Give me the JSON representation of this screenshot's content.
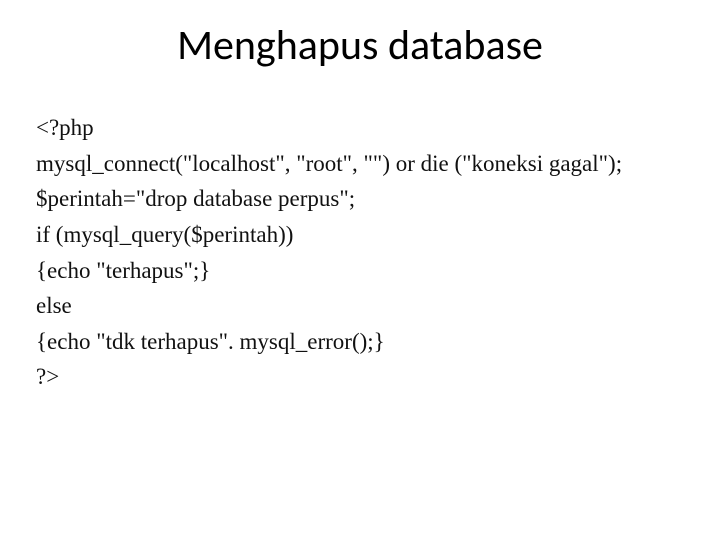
{
  "title": "Menghapus database",
  "code": {
    "l1": "<?php",
    "l2": "mysql_connect(\"localhost\", \"root\", \"\") or die (\"koneksi gagal\");",
    "l3": "$perintah=\"drop database perpus\";",
    "l4": "if (mysql_query($perintah))",
    "l5": "{echo \"terhapus\";}",
    "l6": "else",
    "l7": "{echo \"tdk terhapus\". mysql_error();}",
    "l8": "?>"
  }
}
